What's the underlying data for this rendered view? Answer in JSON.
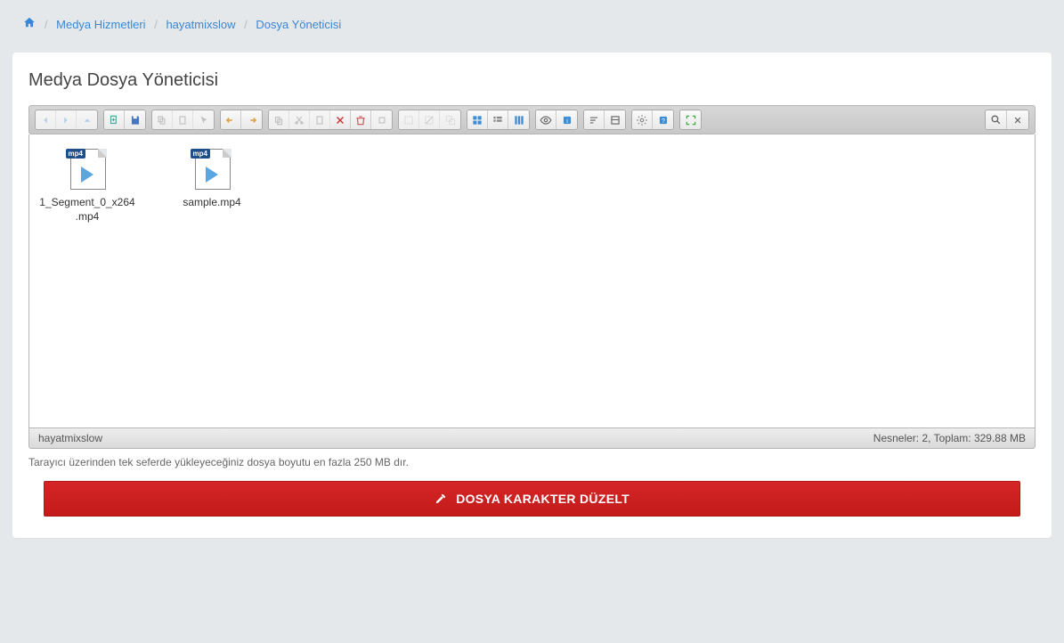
{
  "breadcrumb": {
    "home_label": "Home",
    "items": [
      {
        "label": "Medya Hizmetleri"
      },
      {
        "label": "hayatmixslow"
      },
      {
        "label": "Dosya Yöneticisi"
      }
    ]
  },
  "page_title": "Medya Dosya Yöneticisi",
  "files": [
    {
      "name": "1_Segment_0_x264.mp4",
      "badge": "mp4"
    },
    {
      "name": "sample.mp4",
      "badge": "mp4"
    }
  ],
  "status": {
    "left": "hayatmixslow",
    "right": "Nesneler: 2, Toplam: 329.88 MB"
  },
  "hint": "Tarayıcı üzerinden tek seferde yükleyeceğiniz dosya boyutu en fazla 250 MB dır.",
  "fix_button": "DOSYA KARAKTER DÜZELT",
  "toolbar": {
    "groups": [
      {
        "buttons": [
          {
            "name": "back-icon",
            "disabled": true
          },
          {
            "name": "forward-icon",
            "disabled": true
          },
          {
            "name": "up-icon",
            "disabled": true
          }
        ]
      },
      {
        "buttons": [
          {
            "name": "new-file-icon"
          },
          {
            "name": "save-icon"
          }
        ]
      },
      {
        "buttons": [
          {
            "name": "copy-icon",
            "disabled": true
          },
          {
            "name": "paste-icon",
            "disabled": true
          },
          {
            "name": "cursor-icon",
            "disabled": true
          }
        ]
      },
      {
        "buttons": [
          {
            "name": "undo-icon"
          },
          {
            "name": "redo-icon"
          }
        ]
      },
      {
        "buttons": [
          {
            "name": "duplicate-icon",
            "disabled": true
          },
          {
            "name": "cut-icon",
            "disabled": true
          },
          {
            "name": "clipboard-icon",
            "disabled": true
          },
          {
            "name": "delete-icon"
          },
          {
            "name": "trash-icon"
          },
          {
            "name": "clear-icon",
            "disabled": true
          }
        ]
      },
      {
        "buttons": [
          {
            "name": "select-icon",
            "disabled": true
          },
          {
            "name": "deselect-icon",
            "disabled": true
          },
          {
            "name": "invert-icon",
            "disabled": true
          }
        ]
      },
      {
        "buttons": [
          {
            "name": "grid-view-icon"
          },
          {
            "name": "list-view-icon"
          },
          {
            "name": "column-view-icon"
          }
        ]
      },
      {
        "buttons": [
          {
            "name": "preview-icon"
          },
          {
            "name": "info-icon"
          }
        ]
      },
      {
        "buttons": [
          {
            "name": "sort-icon"
          },
          {
            "name": "props-icon"
          }
        ]
      },
      {
        "buttons": [
          {
            "name": "settings-icon"
          },
          {
            "name": "help-icon"
          }
        ]
      },
      {
        "buttons": [
          {
            "name": "fullscreen-icon"
          }
        ]
      }
    ]
  }
}
